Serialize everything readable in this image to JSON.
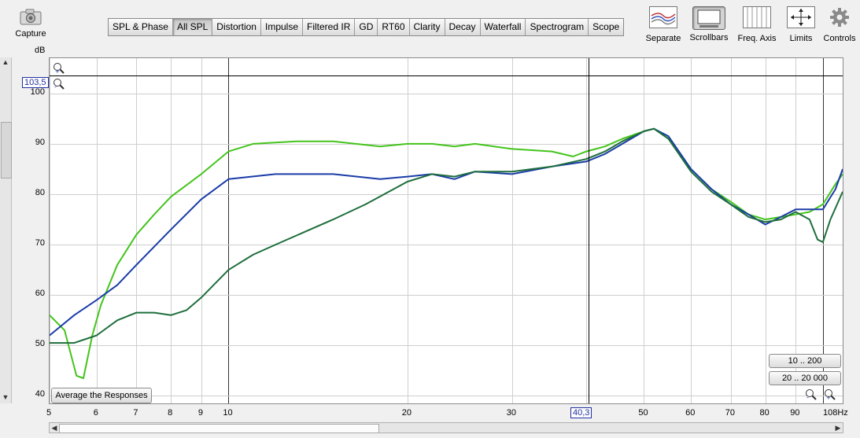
{
  "toolbar": {
    "capture_label": "Capture",
    "tabs": [
      "SPL & Phase",
      "All SPL",
      "Distortion",
      "Impulse",
      "Filtered IR",
      "GD",
      "RT60",
      "Clarity",
      "Decay",
      "Waterfall",
      "Spectrogram",
      "Scope"
    ],
    "active_tab": "All SPL",
    "tools": {
      "separate": "Separate",
      "scrollbars": "Scrollbars",
      "freq_axis": "Freq. Axis",
      "limits": "Limits",
      "controls": "Controls"
    }
  },
  "plot": {
    "y_unit": "dB",
    "x_unit": "Hz",
    "y_ticks": [
      "100",
      "90",
      "80",
      "70",
      "60",
      "50",
      "40"
    ],
    "x_ticks": [
      "5",
      "6",
      "7",
      "8",
      "9",
      "10",
      "20",
      "30",
      "40",
      "50",
      "60",
      "70",
      "80",
      "90",
      "108Hz"
    ],
    "cursor_y_value": "103,5",
    "cursor_x_value": "40,3",
    "average_button": "Average the Responses",
    "range_button_1": "10 .. 200",
    "range_button_2": "20 .. 20 000"
  },
  "chart_data": {
    "type": "line",
    "xlabel": "",
    "ylabel": "dB",
    "xlim": [
      5,
      108
    ],
    "ylim": [
      38.5,
      107
    ],
    "x_scale": "log",
    "grid": true,
    "series": [
      {
        "color": "#44c41c",
        "points": [
          [
            5,
            56
          ],
          [
            5.3,
            53
          ],
          [
            5.55,
            44
          ],
          [
            5.7,
            43.5
          ],
          [
            5.9,
            52
          ],
          [
            6.1,
            58
          ],
          [
            6.5,
            66
          ],
          [
            7,
            72
          ],
          [
            7.5,
            76
          ],
          [
            8,
            79.5
          ],
          [
            9,
            84
          ],
          [
            10,
            88.5
          ],
          [
            11,
            90
          ],
          [
            13,
            90.5
          ],
          [
            15,
            90.5
          ],
          [
            18,
            89.5
          ],
          [
            20,
            90
          ],
          [
            22,
            90
          ],
          [
            24,
            89.5
          ],
          [
            26,
            90
          ],
          [
            30,
            89
          ],
          [
            35,
            88.5
          ],
          [
            38,
            87.5
          ],
          [
            40,
            88.5
          ],
          [
            43,
            89.5
          ],
          [
            46,
            91
          ],
          [
            50,
            92.5
          ],
          [
            52,
            93
          ],
          [
            55,
            91
          ],
          [
            60,
            85
          ],
          [
            65,
            81
          ],
          [
            70,
            78.5
          ],
          [
            75,
            76
          ],
          [
            80,
            75
          ],
          [
            85,
            75.5
          ],
          [
            90,
            76
          ],
          [
            95,
            76.5
          ],
          [
            100,
            78
          ],
          [
            105,
            82
          ],
          [
            108,
            84
          ]
        ]
      },
      {
        "color": "#1a3ca8",
        "points": [
          [
            5,
            52
          ],
          [
            5.5,
            56
          ],
          [
            6,
            59
          ],
          [
            6.5,
            62
          ],
          [
            7,
            66
          ],
          [
            8,
            73
          ],
          [
            9,
            79
          ],
          [
            10,
            83
          ],
          [
            12,
            84
          ],
          [
            15,
            84
          ],
          [
            18,
            83
          ],
          [
            20,
            83.5
          ],
          [
            22,
            84
          ],
          [
            24,
            83
          ],
          [
            26,
            84.5
          ],
          [
            30,
            84
          ],
          [
            35,
            85.5
          ],
          [
            40,
            86.5
          ],
          [
            43,
            88
          ],
          [
            46,
            90
          ],
          [
            50,
            92.5
          ],
          [
            52,
            93
          ],
          [
            55,
            91.5
          ],
          [
            60,
            85
          ],
          [
            65,
            81
          ],
          [
            70,
            78
          ],
          [
            75,
            76
          ],
          [
            80,
            74
          ],
          [
            85,
            75.5
          ],
          [
            90,
            77
          ],
          [
            95,
            77
          ],
          [
            100,
            77
          ],
          [
            105,
            81
          ],
          [
            108,
            85
          ]
        ]
      },
      {
        "color": "#1e6e3c",
        "points": [
          [
            5,
            50.5
          ],
          [
            5.5,
            50.5
          ],
          [
            6,
            52
          ],
          [
            6.5,
            55
          ],
          [
            7,
            56.5
          ],
          [
            7.5,
            56.5
          ],
          [
            8,
            56
          ],
          [
            8.5,
            57
          ],
          [
            9,
            59.5
          ],
          [
            10,
            65
          ],
          [
            11,
            68
          ],
          [
            12,
            70
          ],
          [
            15,
            75
          ],
          [
            17,
            78
          ],
          [
            20,
            82.5
          ],
          [
            22,
            84
          ],
          [
            24,
            83.5
          ],
          [
            26,
            84.5
          ],
          [
            30,
            84.5
          ],
          [
            35,
            85.5
          ],
          [
            40,
            87
          ],
          [
            43,
            88.5
          ],
          [
            46,
            90.5
          ],
          [
            50,
            92.5
          ],
          [
            52,
            93
          ],
          [
            55,
            91
          ],
          [
            60,
            84.5
          ],
          [
            65,
            80.5
          ],
          [
            70,
            78
          ],
          [
            75,
            75.5
          ],
          [
            80,
            74.5
          ],
          [
            85,
            75
          ],
          [
            90,
            76.5
          ],
          [
            95,
            75
          ],
          [
            98,
            71
          ],
          [
            100,
            70.5
          ],
          [
            103,
            75
          ],
          [
            108,
            80.5
          ]
        ]
      }
    ]
  }
}
